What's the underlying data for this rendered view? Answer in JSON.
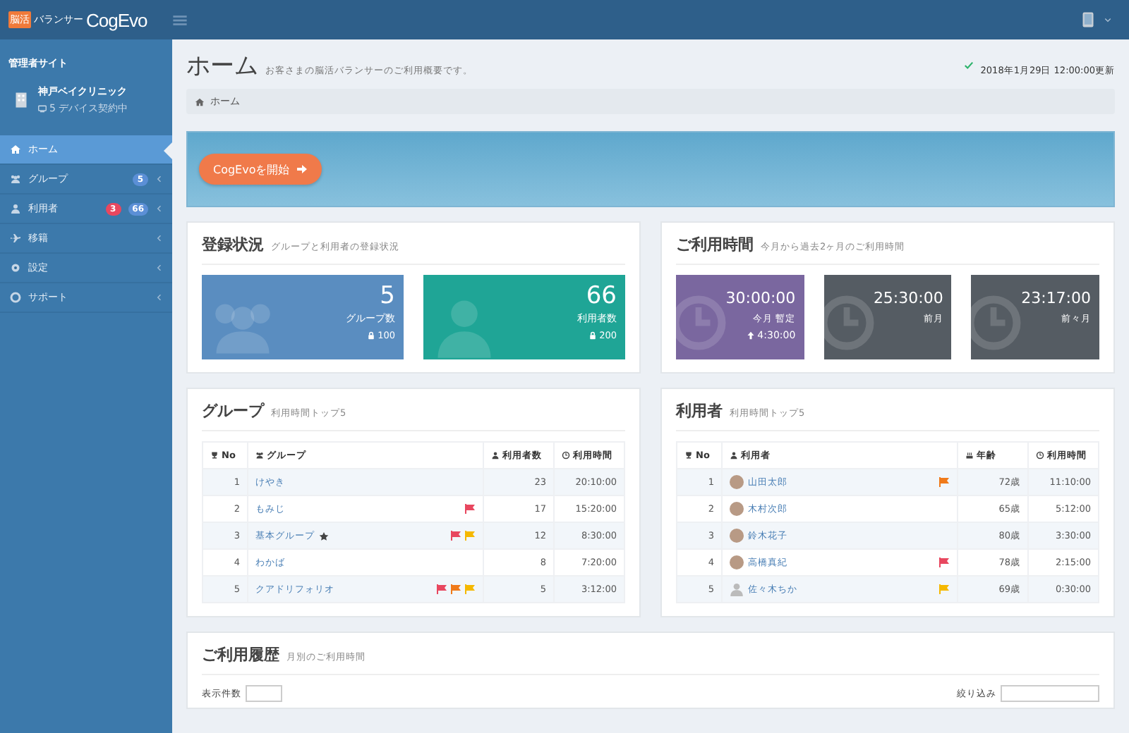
{
  "header": {
    "logo_tag": "脳活",
    "logo_sub": "バランサー",
    "logo_main": "CogEvo"
  },
  "sidebar": {
    "site_label": "管理者サイト",
    "facility": {
      "name": "神戸ベイクリニック",
      "note": "5 デバイス契約中"
    },
    "items": [
      {
        "label": "ホーム",
        "selected": true,
        "expandable": false
      },
      {
        "label": "グループ",
        "selected": false,
        "badges": [
          {
            "text": "5",
            "color": "#5b8fd6"
          }
        ],
        "expandable": true
      },
      {
        "label": "利用者",
        "selected": false,
        "badges": [
          {
            "text": "3",
            "color": "#e8475f"
          },
          {
            "text": "66",
            "color": "#5b8fd6"
          }
        ],
        "expandable": true
      },
      {
        "label": "移籍",
        "selected": false,
        "expandable": true
      },
      {
        "label": "設定",
        "selected": false,
        "expandable": true
      },
      {
        "label": "サポート",
        "selected": false,
        "expandable": true
      }
    ]
  },
  "page": {
    "title": "ホーム",
    "subtitle": "お客さまの脳活バランサーのご利用概要です。",
    "updated": "2018年1月29日 12:00:00更新",
    "breadcrumb": "ホーム",
    "start_button": "CogEvoを開始"
  },
  "registration": {
    "title": "登録状況",
    "subtitle": "グループと利用者の登録状況",
    "tiles": [
      {
        "kind": "group",
        "value": "5",
        "label": "グループ数",
        "limit": "100",
        "color": "#5a8dc0"
      },
      {
        "kind": "user",
        "value": "66",
        "label": "利用者数",
        "limit": "200",
        "color": "#1fa596"
      }
    ]
  },
  "usage": {
    "title": "ご利用時間",
    "subtitle": "今月から過去2ヶ月のご利用時間",
    "tiles": [
      {
        "value": "30:00:00",
        "label": "今月",
        "tag": "暫定",
        "change": "4:30:00",
        "color": "#7a679f"
      },
      {
        "value": "25:30:00",
        "label": "前月",
        "color": "#555c63"
      },
      {
        "value": "23:17:00",
        "label": "前々月",
        "color": "#555c63"
      }
    ]
  },
  "groups": {
    "title": "グループ",
    "subtitle": "利用時間トップ5",
    "columns": [
      "No",
      "グループ",
      "利用者数",
      "利用時間"
    ],
    "rows": [
      {
        "no": "1",
        "name": "けやき",
        "starred": false,
        "count": "23",
        "time": "20:10:00"
      },
      {
        "no": "2",
        "name": "もみじ",
        "starred": false,
        "flags": [
          {
            "color": "#e8475f"
          }
        ],
        "count": "17",
        "time": "15:20:00"
      },
      {
        "no": "3",
        "name": "基本グループ",
        "starred": true,
        "flags": [
          {
            "color": "#e8475f"
          },
          {
            "color": "#f5b800"
          }
        ],
        "count": "12",
        "time": "8:30:00"
      },
      {
        "no": "4",
        "name": "わかば",
        "starred": false,
        "count": "8",
        "time": "7:20:00"
      },
      {
        "no": "5",
        "name": "クアドリフォリオ",
        "starred": false,
        "flags": [
          {
            "color": "#e8475f"
          },
          {
            "color": "#f07a1a"
          },
          {
            "color": "#f5b800"
          }
        ],
        "count": "5",
        "time": "3:12:00"
      }
    ]
  },
  "users": {
    "title": "利用者",
    "subtitle": "利用時間トップ5",
    "columns": [
      "No",
      "利用者",
      "年齢",
      "利用時間"
    ],
    "rows": [
      {
        "no": "1",
        "name": "山田太郎",
        "has_photo": true,
        "flags": [
          {
            "color": "#f07a1a"
          }
        ],
        "age": "72歳",
        "time": "11:10:00"
      },
      {
        "no": "2",
        "name": "木村次郎",
        "has_photo": true,
        "age": "65歳",
        "time": "5:12:00"
      },
      {
        "no": "3",
        "name": "鈴木花子",
        "has_photo": true,
        "age": "80歳",
        "time": "3:30:00"
      },
      {
        "no": "4",
        "name": "高橋真紀",
        "has_photo": true,
        "flags": [
          {
            "color": "#e8475f"
          }
        ],
        "age": "78歳",
        "time": "2:15:00"
      },
      {
        "no": "5",
        "name": "佐々木ちか",
        "has_photo": false,
        "flags": [
          {
            "color": "#f5b800"
          }
        ],
        "age": "69歳",
        "time": "0:30:00"
      }
    ]
  },
  "history": {
    "title": "ご利用履歴",
    "subtitle": "月別のご利用時間",
    "show_label": "表示件数",
    "filter_label": "絞り込み"
  }
}
